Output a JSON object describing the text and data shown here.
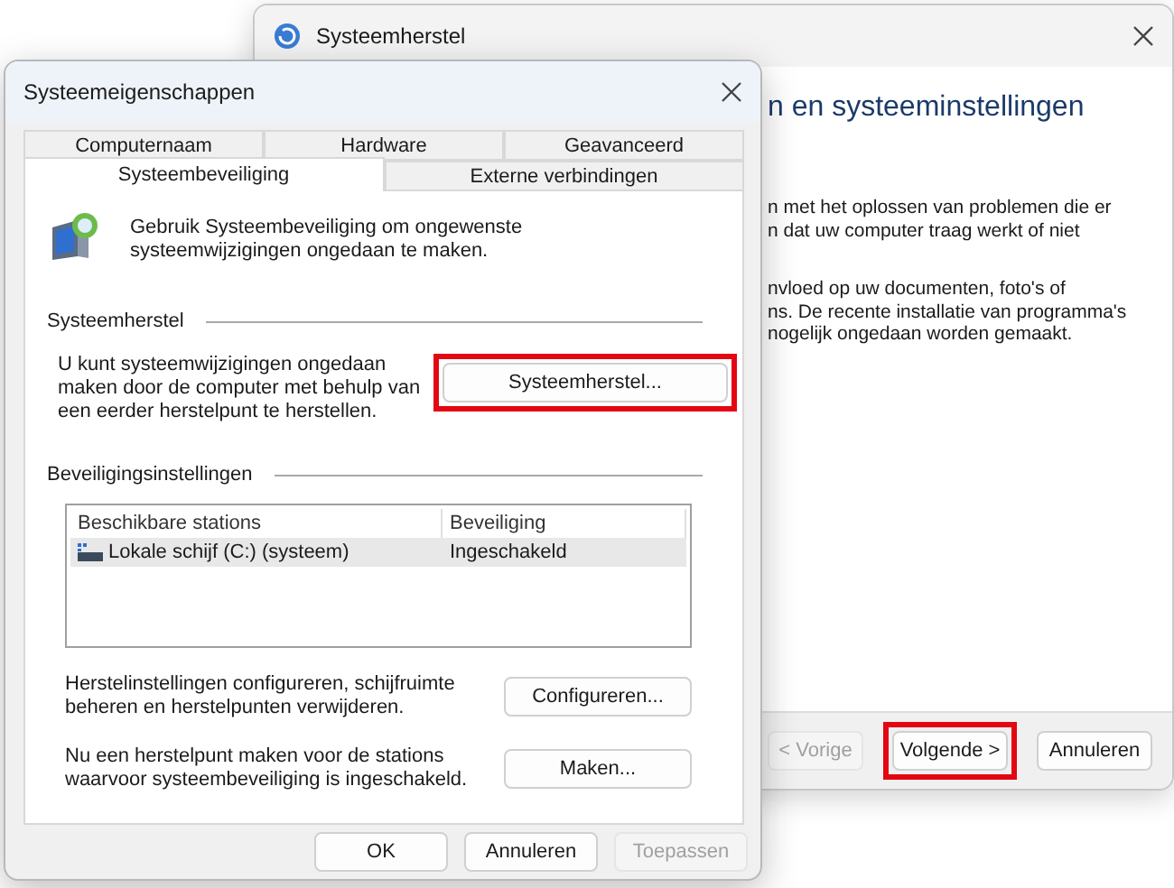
{
  "back_window": {
    "title": "Systeemherstel",
    "heading": "n en systeeminstellingen",
    "paragraphs": [
      [
        "n met het oplossen van problemen die er",
        "n dat uw computer traag werkt of niet"
      ],
      [
        "nvloed op uw documenten, foto's of",
        "ns. De recente installatie van programma's",
        "nogelijk ongedaan worden gemaakt."
      ]
    ],
    "buttons": [
      {
        "label": "< Vorige",
        "disabled": true,
        "highlighted": false
      },
      {
        "label": "Volgende >",
        "disabled": false,
        "highlighted": true
      },
      {
        "label": "Annuleren",
        "disabled": false,
        "highlighted": false
      }
    ]
  },
  "dialog": {
    "title": "Systeemeigenschappen",
    "tab_rows": [
      [
        {
          "label": "Computernaam",
          "selected": false
        },
        {
          "label": "Hardware",
          "selected": false
        },
        {
          "label": "Geavanceerd",
          "selected": false
        }
      ],
      [
        {
          "label": "Systeembeveiliging",
          "selected": true
        },
        {
          "label": "Externe verbindingen",
          "selected": false
        }
      ]
    ],
    "intro": "Gebruik Systeembeveiliging om ongewenste systeemwijzigingen ongedaan te maken.",
    "restore_section": {
      "title": "Systeemherstel",
      "text": "U kunt systeemwijzigingen ongedaan maken door de computer met behulp van een eerder herstelpunt te herstellen.",
      "button": {
        "label": "Systeemherstel...",
        "highlighted": true
      }
    },
    "protection_section": {
      "title": "Beveiligingsinstellingen",
      "columns": [
        "Beschikbare stations",
        "Beveiliging"
      ],
      "rows": [
        {
          "cells": [
            "Lokale schijf (C:) (systeem)",
            "Ingeschakeld"
          ],
          "selected": true
        }
      ],
      "actions": [
        {
          "text": "Herstelinstellingen configureren, schijfruimte beheren en herstelpunten verwijderen.",
          "button": "Configureren..."
        },
        {
          "text": "Nu een herstelpunt maken voor de stations waarvoor systeembeveiliging is ingeschakeld.",
          "button": "Maken..."
        }
      ]
    },
    "buttons": [
      {
        "label": "OK",
        "disabled": false
      },
      {
        "label": "Annuleren",
        "disabled": false
      },
      {
        "label": "Toepassen",
        "disabled": true
      }
    ]
  }
}
